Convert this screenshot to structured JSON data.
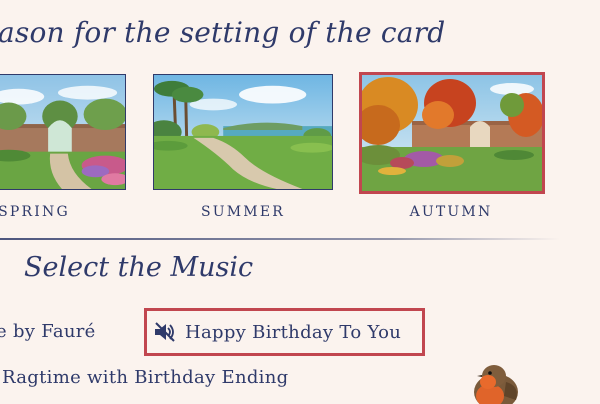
{
  "season_section": {
    "heading": "ason for the setting of the card",
    "seasons": [
      {
        "label": "SPRING",
        "selected": false
      },
      {
        "label": "SUMMER",
        "selected": false
      },
      {
        "label": "AUTUMN",
        "selected": true
      }
    ]
  },
  "music_section": {
    "heading": "Select the Music",
    "options": [
      {
        "label": "e by Fauré",
        "selected": false
      },
      {
        "label": "Happy Birthday To You",
        "selected": true,
        "icon": "speaker-muted-icon"
      },
      {
        "label": "Ragtime with Birthday Ending",
        "selected": false
      }
    ]
  },
  "colors": {
    "background": "#fbf3ee",
    "text": "#2f3a6a",
    "selection_border": "#c1464f"
  }
}
